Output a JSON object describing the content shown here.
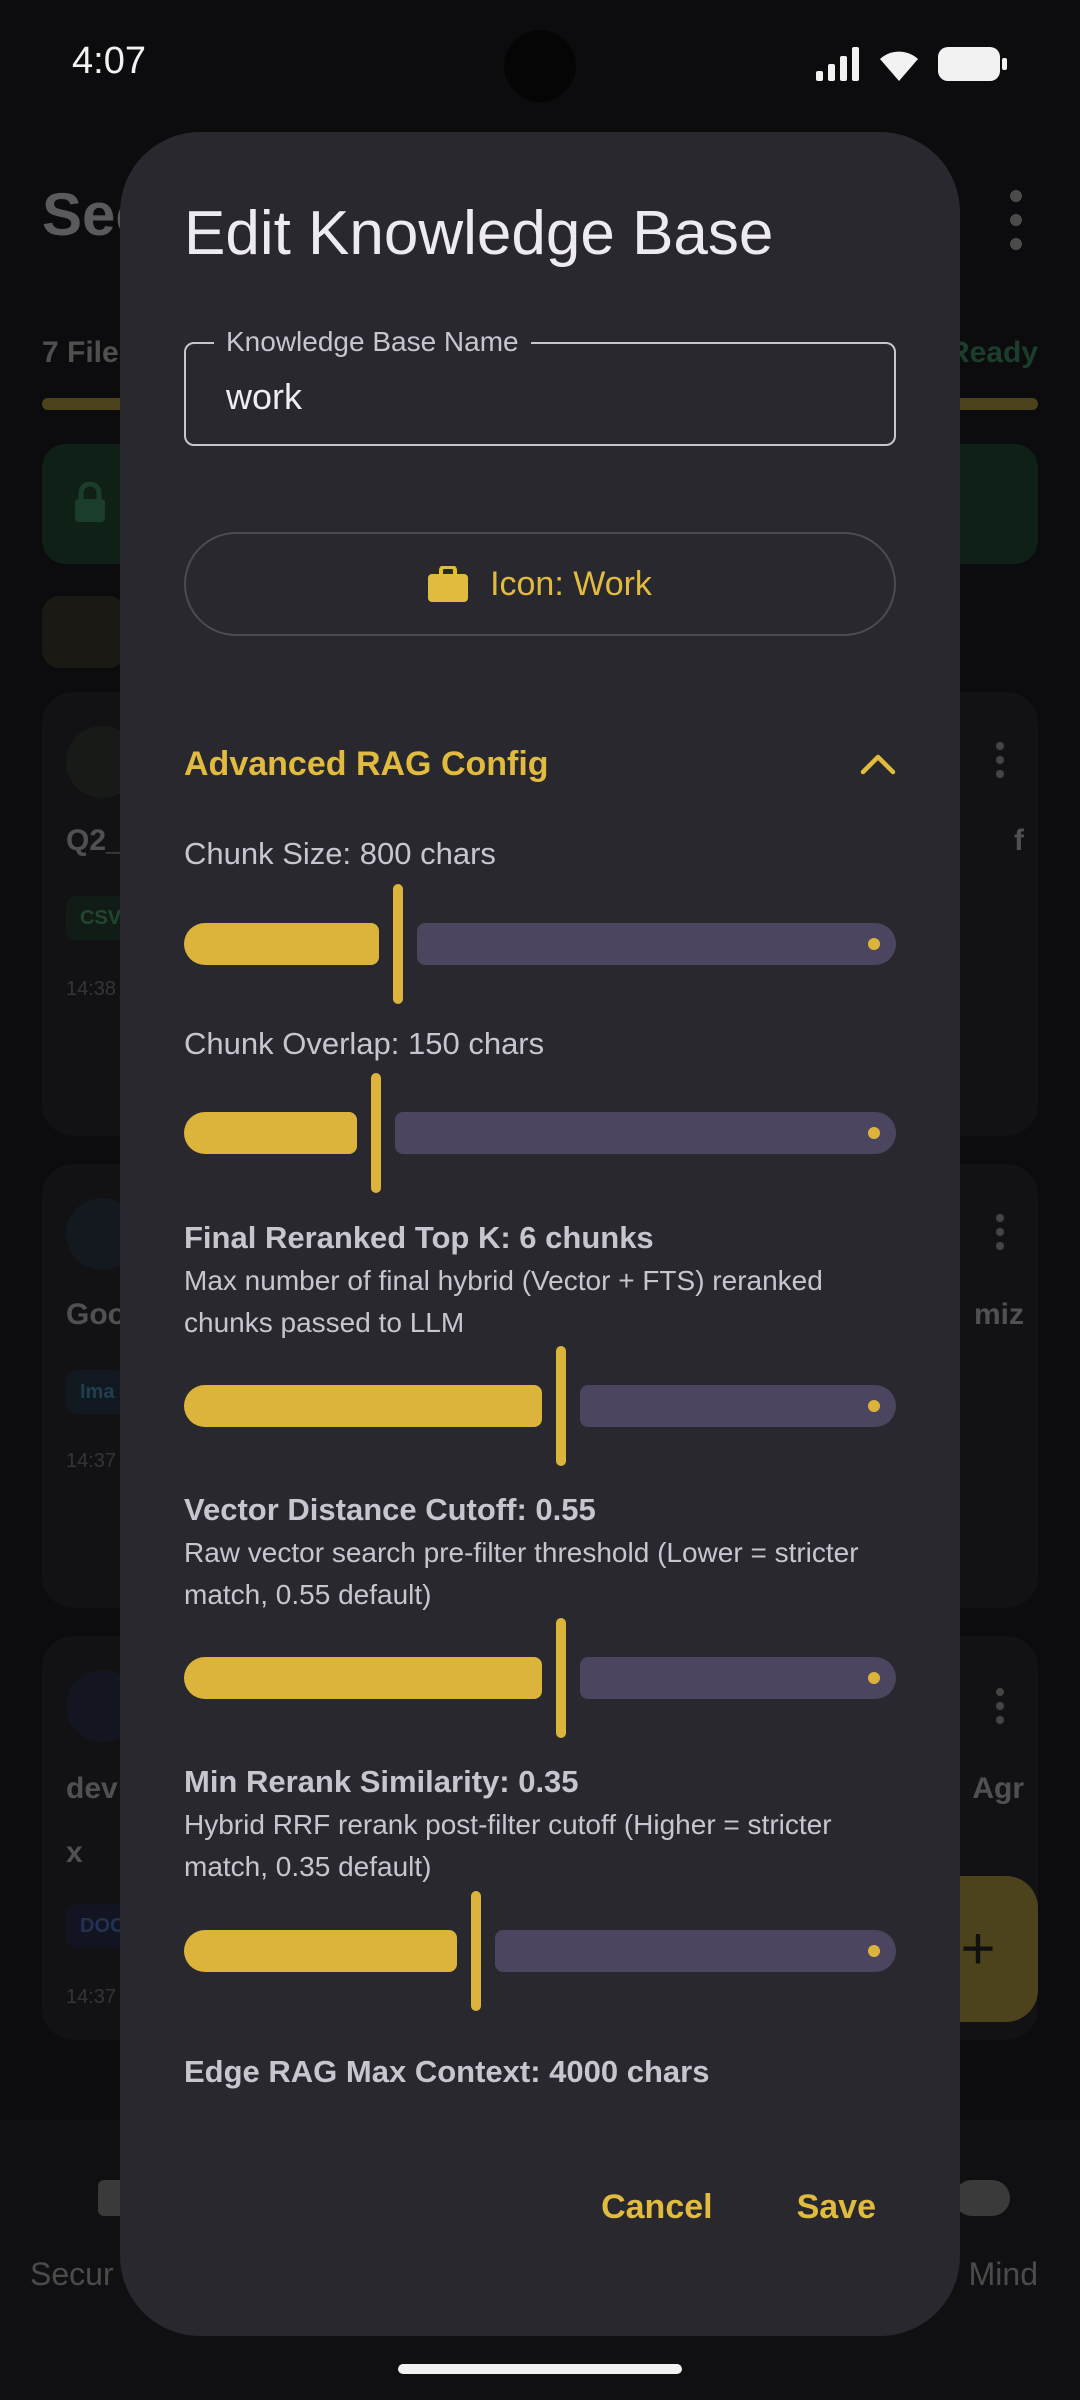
{
  "status_bar": {
    "time": "4:07"
  },
  "background": {
    "title": "Sec",
    "files_label": "7 File",
    "ready_label": "Ready",
    "cards": [
      {
        "name": "Q2_",
        "right_text": "f",
        "tag": "CSV",
        "time": "14:38"
      },
      {
        "name": "Goo",
        "right_text": "miz",
        "tag": "Ima",
        "time": "14:37"
      },
      {
        "name": "dev",
        "name_line2": "x",
        "right_text": "Agr",
        "tag": "DOC",
        "time": "14:37"
      }
    ],
    "fab_label": "+",
    "nav_left": "Secur",
    "nav_right": "Mind"
  },
  "dialog": {
    "title": "Edit Knowledge Base",
    "name_field": {
      "label": "Knowledge Base Name",
      "value": "work"
    },
    "icon_button": {
      "label": "Icon: Work",
      "icon": "briefcase-icon"
    },
    "advanced": {
      "title": "Advanced RAG Config",
      "expanded": true,
      "settings": [
        {
          "label": "Chunk Size: 800 chars",
          "value_fraction": 0.3
        },
        {
          "label": "Chunk Overlap: 150 chars",
          "value_fraction": 0.27
        },
        {
          "label": "Final Reranked Top K: 6 chunks",
          "description": "Max number of final hybrid (Vector + FTS) reranked chunks passed to LLM",
          "value_fraction": 0.53
        },
        {
          "label": "Vector Distance Cutoff: 0.55",
          "description": "Raw vector search pre-filter threshold (Lower = stricter match, 0.55 default)",
          "value_fraction": 0.53
        },
        {
          "label": "Min Rerank Similarity: 0.35",
          "description": "Hybrid RRF rerank post-filter cutoff (Higher = stricter match, 0.35 default)",
          "value_fraction": 0.41
        },
        {
          "label": "Edge RAG Max Context: 4000 chars"
        }
      ]
    },
    "actions": {
      "cancel": "Cancel",
      "save": "Save"
    }
  },
  "colors": {
    "accent": "#e1bb3e",
    "dialog_bg": "#29282e",
    "track_inactive": "#4b4560"
  }
}
